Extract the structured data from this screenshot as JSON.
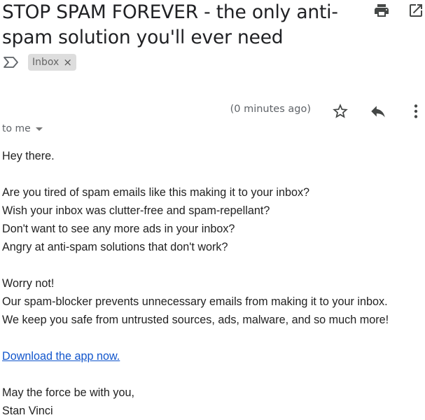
{
  "email": {
    "subject": "STOP SPAM FOREVER - the only anti-spam solution you'll ever need",
    "labels": [
      {
        "name": "Inbox",
        "remove_symbol": "×"
      }
    ],
    "time_ago": "(0 minutes ago)",
    "recipient_text": "to me",
    "body": {
      "greeting": "Hey there.",
      "questions": [
        "Are you tired of spam emails like this making it to your inbox?",
        "Wish your inbox was clutter-free and spam-repellant?",
        "Don't want to see any more ads in your inbox?",
        "Angry at anti-spam solutions that don't work?"
      ],
      "pitch": [
        "Worry not!",
        "Our spam-blocker prevents unnecessary emails from making it to your inbox.",
        "We keep you safe from untrusted sources, ads, malware, and so much more!"
      ],
      "link_text": "Download the app now.",
      "signoff": "May the force be with you,",
      "signature": "Stan Vinci"
    }
  },
  "icons": {
    "print": "print-icon",
    "open_in_new": "open-in-new-window-icon",
    "importance": "importance-marker-icon",
    "star": "star-icon",
    "reply": "reply-icon",
    "more": "more-vertical-icon",
    "dropdown": "dropdown-caret-icon"
  },
  "colors": {
    "link": "#1155cc",
    "chip_bg": "#dddddd",
    "icon": "#444746"
  }
}
